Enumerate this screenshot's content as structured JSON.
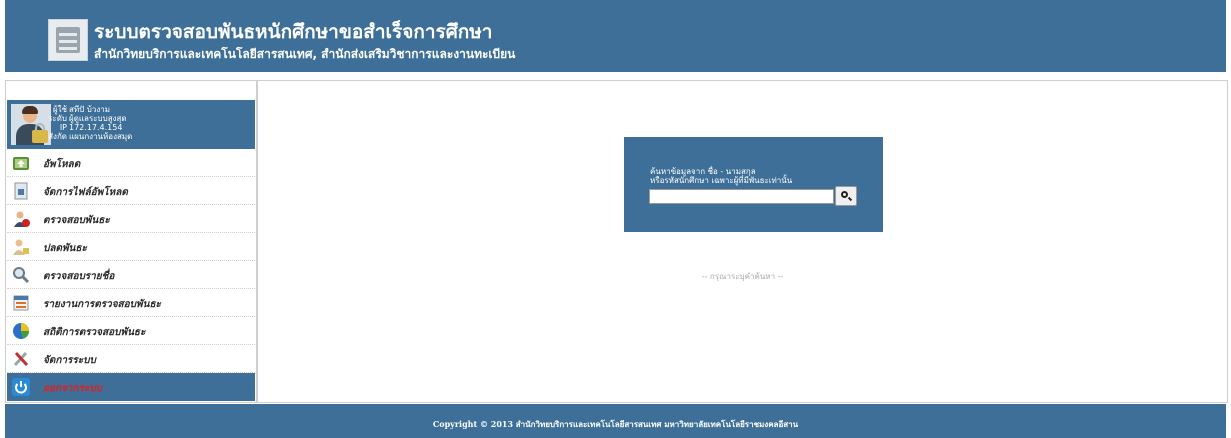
{
  "header": {
    "title": "ระบบตรวจสอบพันธหนักศึกษาขอสำเร็จการศึกษา",
    "subtitle": "สำนักวิทยบริการและเทคโนโลยีสารสนเทศ, สำนักส่งเสริมวิชาการและงานทะเบียน"
  },
  "user": {
    "labels": [
      "ผู้ใช้",
      "ระดับ",
      "IP",
      "สังกัด"
    ],
    "values": [
      "สทีปั บ้วงาม",
      "ผู้ดูแลระบบสูงสุด",
      "172.17.4.154",
      "แผนกงานห้องสมุด"
    ]
  },
  "menu": [
    {
      "label": "อัพโหลด",
      "icon": "upload-icon"
    },
    {
      "label": "จัดการไฟล์อัพโหลด",
      "icon": "file-manage-icon"
    },
    {
      "label": "ตรวจสอบพันธะ",
      "icon": "check-obligation-icon"
    },
    {
      "label": "ปลดพันธะ",
      "icon": "release-user-icon"
    },
    {
      "label": "ตรวจสอบรายชื่อ",
      "icon": "magnifier-icon"
    },
    {
      "label": "รายงานการตรวจสอบพันธะ",
      "icon": "report-icon"
    },
    {
      "label": "สถิติการตรวจสอบพันธะ",
      "icon": "pie-chart-icon"
    },
    {
      "label": "จัดการระบบ",
      "icon": "tools-icon"
    },
    {
      "label": "ออกจากระบบ",
      "icon": "power-icon"
    }
  ],
  "search": {
    "line1": "ค้นหาข้อมูลจาก ชื่อ - นามสกุล",
    "line2": "หรือรหัสนักศึกษา เฉพาะผู้ที่มีพันธะเท่านั้น",
    "value": "",
    "hint": "-- กรุณาระบุคำค้นหา --"
  },
  "footer": {
    "copyright": "Copyright © 2013 สำนักวิทยบริการและเทคโนโลยีสารสนเทศ มหาวิทยาลัยเทคโนโลยีราชมงคลอีสาน"
  },
  "colors": {
    "primary": "#3d6f98",
    "logout_text": "#e02020"
  }
}
